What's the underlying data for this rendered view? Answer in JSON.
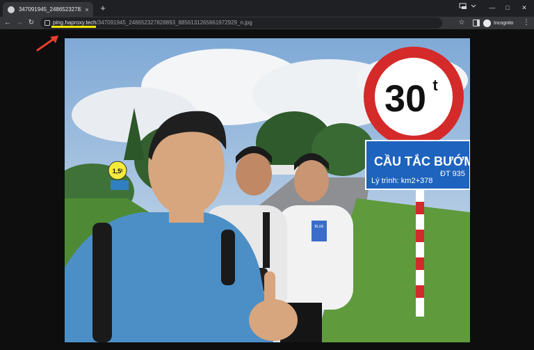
{
  "tab": {
    "title": "347091945_248652327828893_8",
    "close_glyph": "×"
  },
  "newtab_glyph": "+",
  "window": {
    "minimize": "—",
    "maximize": "□",
    "close": "✕"
  },
  "toolbar": {
    "back": "←",
    "forward": "→",
    "reload": "↻",
    "url_host": "ping.haproxy.tech",
    "url_path": "/347091945_248652327828893_8856131265661972929_n.jpg",
    "star": "☆",
    "incognito_label": "Incognito",
    "menu": "⋮"
  },
  "colors": {
    "annotation_arrow": "#e8402d",
    "url_highlight": "#f2e600"
  },
  "photo": {
    "speed_sign_value": "30",
    "speed_sign_unit": "t",
    "bridge_name": "CẦU TẮC BƯỚM",
    "bridge_location": "Lý trình: km2+378",
    "road_code": "ĐT 935",
    "small_sign_value": "1,5ᵗ",
    "shirt_patch_text": "BLUE"
  }
}
